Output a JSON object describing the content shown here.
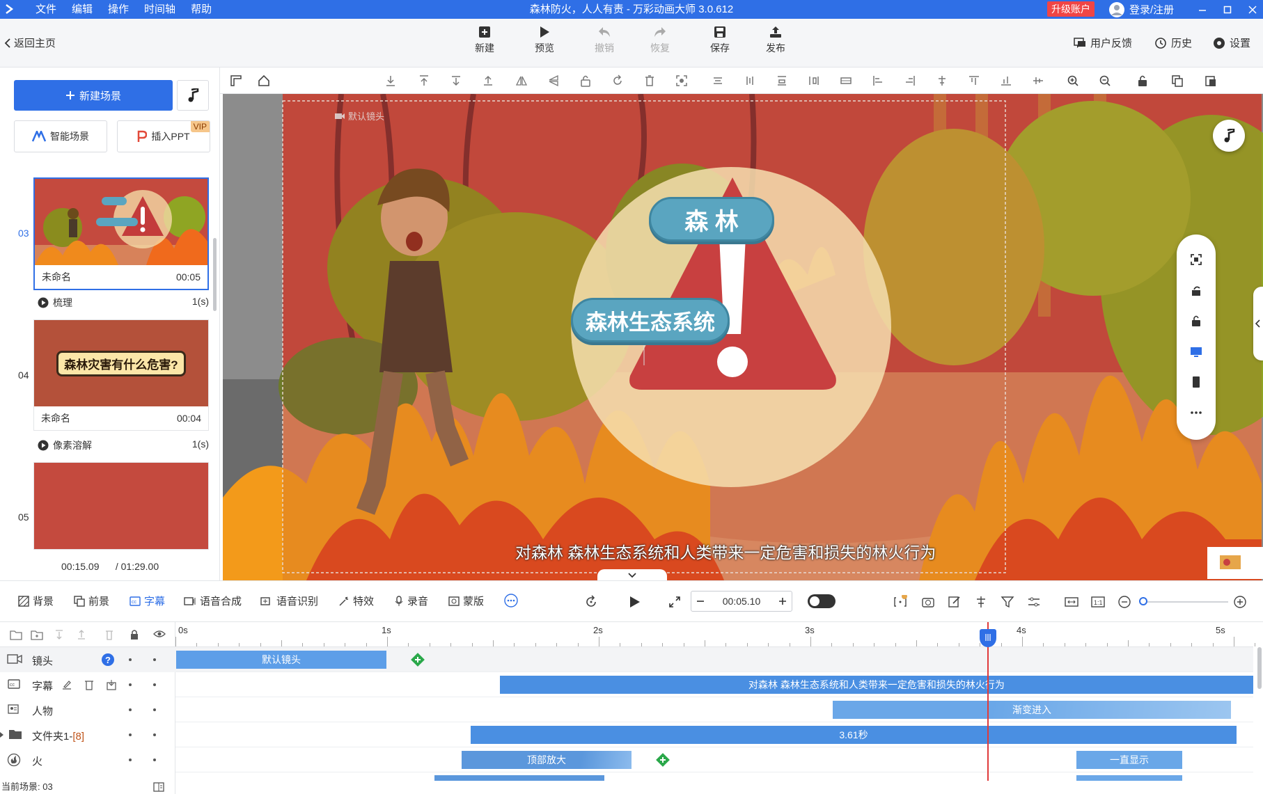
{
  "titlebar": {
    "menu": [
      "文件",
      "编辑",
      "操作",
      "时间轴",
      "帮助"
    ],
    "title": "森林防火，人人有责 - 万彩动画大师 3.0.612",
    "upgrade": "升级账户",
    "login": "登录/注册"
  },
  "toolbar": {
    "back": "返回主页",
    "buttons": [
      {
        "label": "新建",
        "icon": "plus-icon"
      },
      {
        "label": "预览",
        "icon": "play-icon"
      },
      {
        "label": "撤销",
        "icon": "undo-icon"
      },
      {
        "label": "恢复",
        "icon": "redo-icon"
      },
      {
        "label": "保存",
        "icon": "save-icon"
      },
      {
        "label": "发布",
        "icon": "publish-icon"
      }
    ],
    "feedback": "用户反馈",
    "history": "历史",
    "settings": "设置"
  },
  "left": {
    "new_scene": "新建场景",
    "smart_scene": "智能场景",
    "insert_ppt": "插入PPT",
    "vip": "VIP",
    "scenes": [
      {
        "num": "03",
        "name": "未命名",
        "duration": "00:05",
        "selected": true,
        "thumb_tags": [
          "森林",
          "森林生态系统"
        ]
      },
      {
        "num": "04",
        "name": "未命名",
        "duration": "00:04",
        "thumb_text": "森林灾害有什么危害?"
      },
      {
        "num": "05"
      }
    ],
    "transitions": [
      {
        "name": "梳理",
        "duration": "1(s)"
      },
      {
        "name": "像素溶解",
        "duration": "1(s)"
      }
    ],
    "current_time": "00:15.09",
    "total_time": "/ 01:29.00"
  },
  "canvas": {
    "camera_label": "默认镜头",
    "tag1": "森 林",
    "tag2": "森林生态系统",
    "subtitle": "对森林 森林生态系统和人类带来一定危害和损失的林火行为"
  },
  "timeline_toolbar": {
    "items": [
      {
        "label": "背景",
        "icon": "background-icon"
      },
      {
        "label": "前景",
        "icon": "foreground-icon"
      },
      {
        "label": "字幕",
        "icon": "subtitle-icon",
        "active": true
      },
      {
        "label": "语音合成",
        "icon": "tts-icon"
      },
      {
        "label": "语音识别",
        "icon": "asr-icon"
      },
      {
        "label": "特效",
        "icon": "effects-icon"
      },
      {
        "label": "录音",
        "icon": "mic-icon"
      },
      {
        "label": "蒙版",
        "icon": "mask-icon"
      }
    ],
    "time": "00:05.10"
  },
  "timeline": {
    "ruler": [
      "0s",
      "1s",
      "2s",
      "3s",
      "4s",
      "5s"
    ],
    "tracks": [
      {
        "name": "镜头",
        "icon": "camera-icon"
      },
      {
        "name": "字幕",
        "icon": "cc-icon"
      },
      {
        "name": "人物",
        "icon": "person-icon"
      },
      {
        "name": "文件夹1-",
        "suffix": "[8]",
        "icon": "folder-icon"
      },
      {
        "name": "火",
        "icon": "fire-icon"
      }
    ],
    "clips": {
      "camera": "默认镜头",
      "subtitle": "对森林 森林生态系统和人类带来一定危害和损失的林火行为",
      "person": "渐变进入",
      "folder": "3.61秒",
      "fire1": "顶部放大",
      "fire2": "一直显示"
    },
    "playhead_seconds": 3.83,
    "status": "当前场景: 03"
  }
}
